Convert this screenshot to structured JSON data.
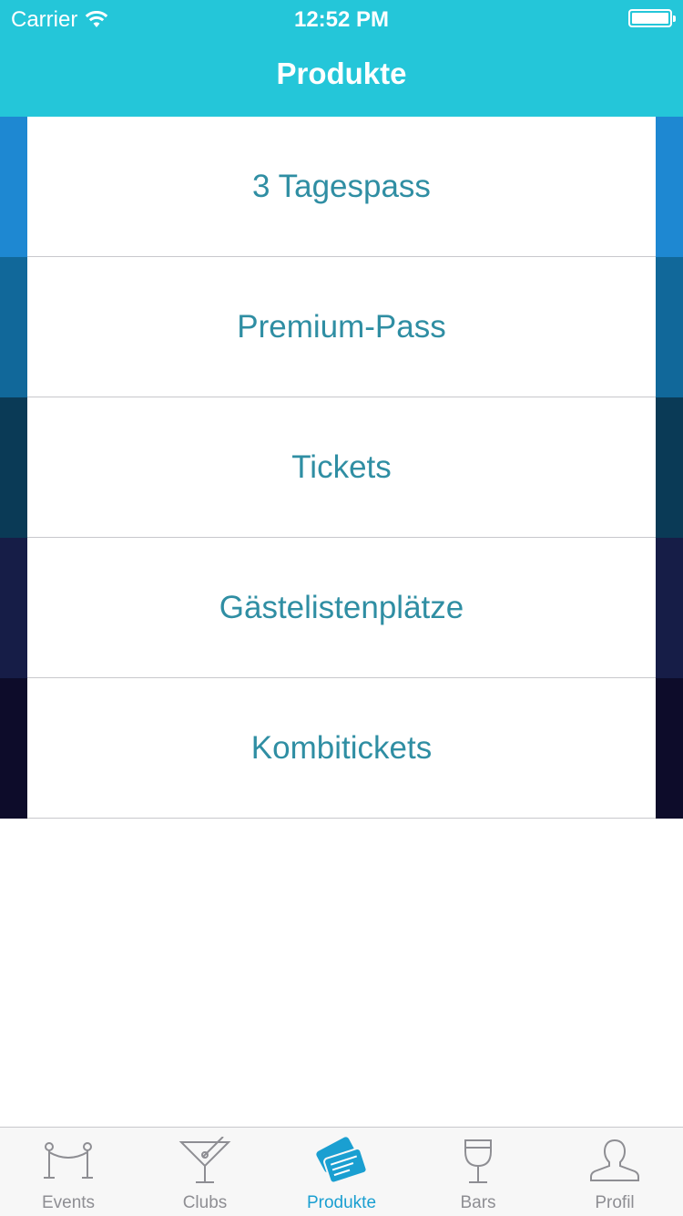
{
  "status_bar": {
    "carrier": "Carrier",
    "time": "12:52 PM"
  },
  "nav": {
    "title": "Produkte"
  },
  "colors": {
    "header_bg": "#24c6d9",
    "accent": "#1a9fd1",
    "row_text": "#2f8ea3",
    "inactive_tab": "#8e8e93"
  },
  "products": [
    {
      "label": "3 Tagespass",
      "edge_color": "#1e88d2"
    },
    {
      "label": "Premium-Pass",
      "edge_color": "#11689a"
    },
    {
      "label": "Tickets",
      "edge_color": "#0a3a56"
    },
    {
      "label": "Gästelistenplätze",
      "edge_color": "#161d47"
    },
    {
      "label": "Kombitickets",
      "edge_color": "#0d0c2a"
    }
  ],
  "tabs": [
    {
      "label": "Events",
      "icon": "rope-barrier-icon",
      "active": false
    },
    {
      "label": "Clubs",
      "icon": "cocktail-glass-icon",
      "active": false
    },
    {
      "label": "Produkte",
      "icon": "tickets-icon",
      "active": true
    },
    {
      "label": "Bars",
      "icon": "wine-glass-icon",
      "active": false
    },
    {
      "label": "Profil",
      "icon": "person-icon",
      "active": false
    }
  ]
}
